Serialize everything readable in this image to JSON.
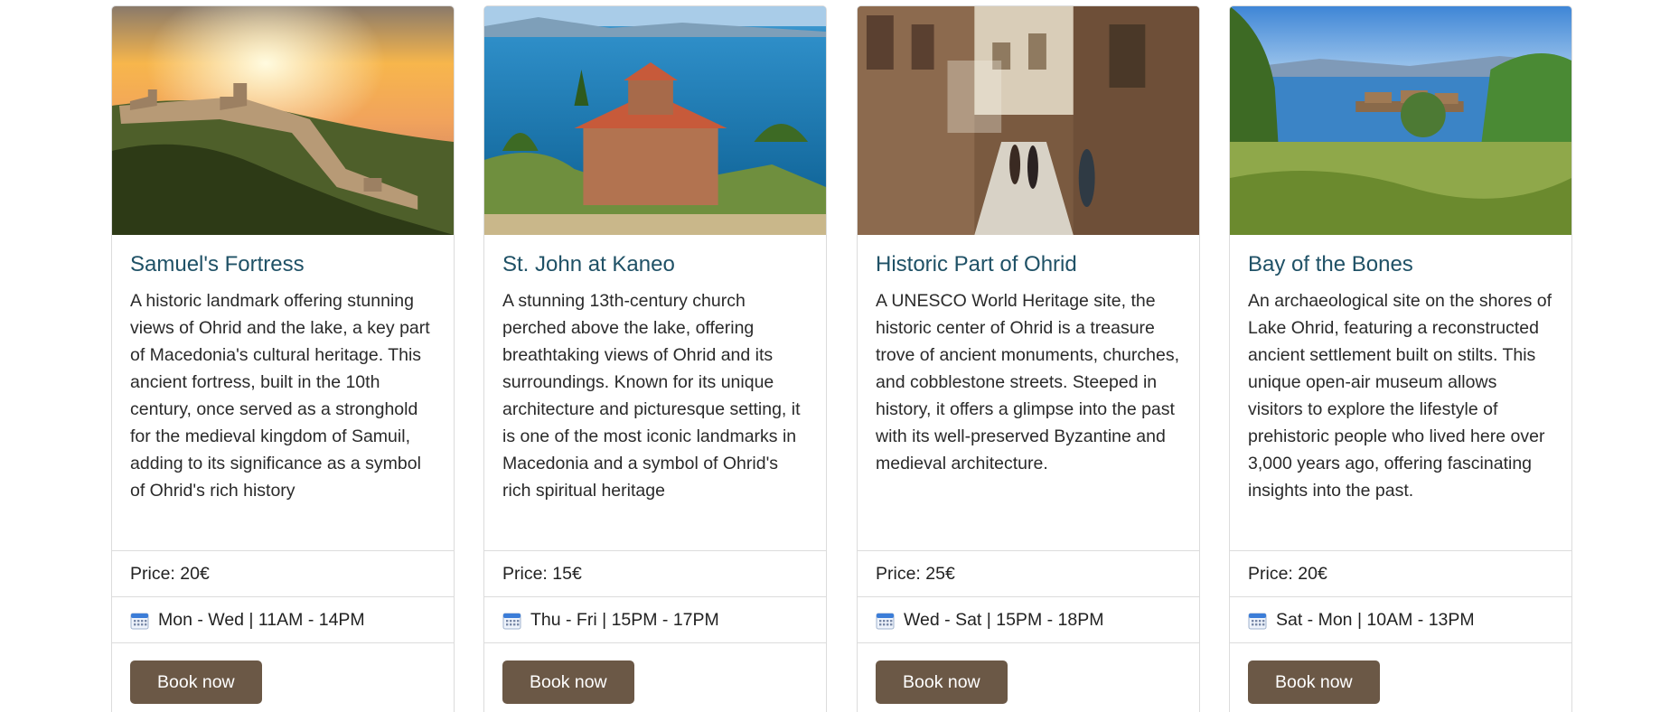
{
  "cards": [
    {
      "title": "Samuel's Fortress",
      "description": "A historic landmark offering stunning views of Ohrid and the lake, a key part of Macedonia's cultural heritage. This ancient fortress, built in the 10th century, once served as a stronghold for the medieval kingdom of Samuil, adding to its significance as a symbol of Ohrid's rich history",
      "price": "Price: 20€",
      "schedule": "Mon - Wed | 11AM - 14PM",
      "button": "Book now",
      "image": "fortress-at-sunset-photo"
    },
    {
      "title": "St. John at Kaneo",
      "description": "A stunning 13th-century church perched above the lake, offering breathtaking views of Ohrid and its surroundings. Known for its unique architecture and picturesque setting, it is one of the most iconic landmarks in Macedonia and a symbol of Ohrid's rich spiritual heritage",
      "price": "Price: 15€",
      "schedule": "Thu - Fri | 15PM - 17PM",
      "button": "Book now",
      "image": "church-above-lake-photo"
    },
    {
      "title": "Historic Part of Ohrid",
      "description": "A UNESCO World Heritage site, the historic center of Ohrid is a treasure trove of ancient monuments, churches, and cobblestone streets. Steeped in history, it offers a glimpse into the past with its well-preserved Byzantine and medieval architecture.",
      "price": "Price: 25€",
      "schedule": "Wed - Sat | 15PM - 18PM",
      "button": "Book now",
      "image": "old-town-street-photo"
    },
    {
      "title": "Bay of the Bones",
      "description": "An archaeological site on the shores of Lake Ohrid, featuring a reconstructed ancient settlement built on stilts. This unique open-air museum allows visitors to explore the lifestyle of prehistoric people who lived here over 3,000 years ago, offering fascinating insights into the past.",
      "price": "Price: 20€",
      "schedule": "Sat - Mon | 10AM - 13PM",
      "button": "Book now",
      "image": "stilt-settlement-on-lake-photo"
    }
  ],
  "icons": {
    "schedule": "calendar-icon"
  },
  "colors": {
    "title": "#1f5166",
    "button": "#6b5846"
  }
}
